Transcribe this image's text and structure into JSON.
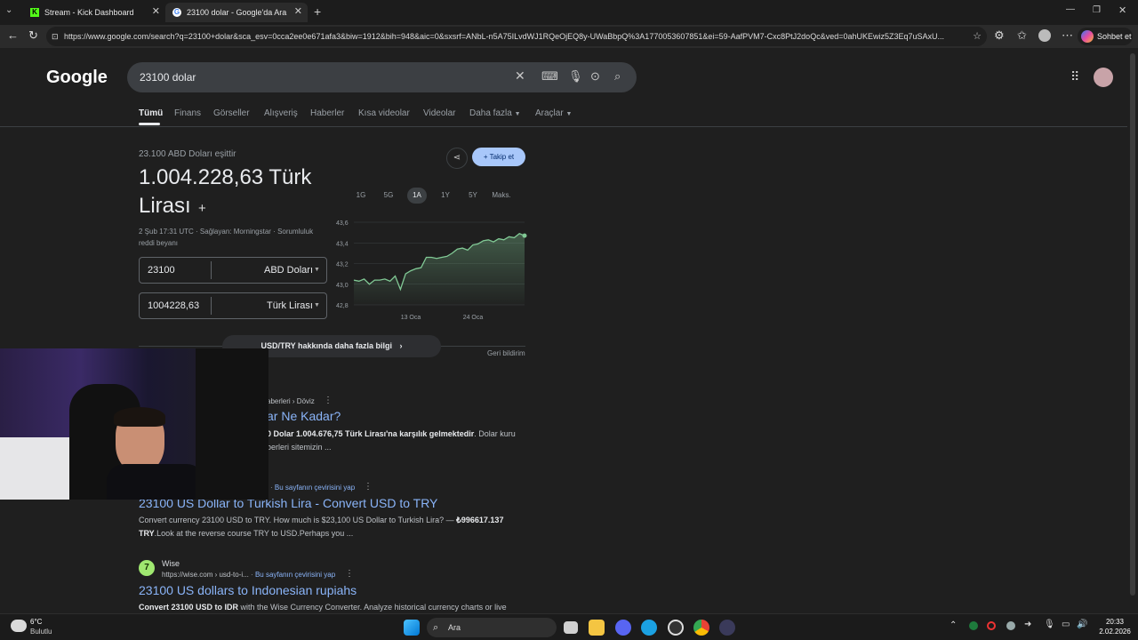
{
  "browser": {
    "tabs": [
      {
        "title": "Stream - Kick Dashboard"
      },
      {
        "title": "23100 dolar - Google'da Ara"
      }
    ],
    "url": "https://www.google.com/search?q=23100+dolar&sca_esv=0cca2ee0e671afa3&biw=1912&bih=948&aic=0&sxsrf=ANbL-n5A75ILvdWJ1RQeOjEQ8y-UWaBbpQ%3A1770053607851&ei=59-AafPVM7-Cxc8PtJ2doQc&ved=0ahUKEwiz5Z3Eq7uSAxU...",
    "copilot_label": "Sohbet et"
  },
  "google": {
    "logo": "Google",
    "query": "23100 dolar",
    "tabs": [
      "Tümü",
      "Finans",
      "Görseller",
      "Alışveriş",
      "Haberler",
      "Kısa videolar",
      "Videolar",
      "Daha fazla",
      "Araçlar"
    ]
  },
  "converter": {
    "subtitle": "23.100 ABD Doları eşittir",
    "result_line1": "1.004.228,63 Türk",
    "result_line2": "Lirası",
    "meta1": "2 Şub 17:31 UTC · Sağlayan: Morningstar · Sorumluluk",
    "meta2": "reddi beyanı",
    "from_value": "23100",
    "from_currency": "ABD Doları",
    "to_value": "1004228,63",
    "to_currency": "Türk Lirası",
    "follow_label": "Takip et",
    "ranges": [
      "1G",
      "5G",
      "1A",
      "1Y",
      "5Y",
      "Maks."
    ],
    "active_range": "1A",
    "more_info": "USD/TRY hakkında daha fazla bilgi",
    "feedback": "Geri bildirim"
  },
  "chart_data": {
    "type": "line",
    "y_ticks": [
      "43,6",
      "43,4",
      "43,2",
      "43,0",
      "42,8"
    ],
    "ylim": [
      42.8,
      43.6
    ],
    "x_ticks": [
      "13 Oca",
      "24 Oca"
    ],
    "values": [
      43.04,
      43.03,
      43.05,
      43.0,
      43.04,
      43.04,
      43.05,
      43.03,
      43.08,
      42.95,
      43.1,
      43.13,
      43.15,
      43.16,
      43.26,
      43.26,
      43.25,
      43.26,
      43.27,
      43.3,
      43.34,
      43.35,
      43.33,
      43.38,
      43.39,
      43.42,
      43.43,
      43.41,
      43.44,
      43.43,
      43.46,
      43.45,
      43.49,
      43.47
    ],
    "color": "#81c995"
  },
  "results": [
    {
      "breadcrumb": "aberleri › Döviz",
      "title": "ar Ne Kadar?",
      "snippet1_bold": "0 Dolar 1.004.676,75 Türk Lirası'na karşılık gelmektedir",
      "snippet1_rest": ". Dolar kuru",
      "snippet2": "berleri sitemizin ..."
    },
    {
      "translate": "Bu sayfanın çevirisini yap",
      "title": "23100 US Dollar to Turkish Lira - Convert USD to TRY",
      "snippet1": "Convert currency 23100 USD to TRY. How much is $23,100 US Dollar to Turkish Lira? — ",
      "snippet1_bold": "₺996617.137",
      "snippet2_bold": "TRY",
      "snippet2": ".Look at the reverse course TRY to USD.Perhaps you ..."
    },
    {
      "site": "Wise",
      "url": "https://wise.com › usd-to-i...",
      "translate": "Bu sayfanın çevirisini yap",
      "title": "23100 US dollars to Indonesian rupiahs",
      "snippet_bold": "Convert 23100 USD to IDR",
      "snippet": " with the Wise Currency Converter. Analyze historical currency charts or live"
    }
  ],
  "taskbar": {
    "weather_temp": "6°C",
    "weather_desc": "Bulutlu",
    "search_label": "Ara",
    "time": "20:33",
    "date": "2.02.2026"
  }
}
